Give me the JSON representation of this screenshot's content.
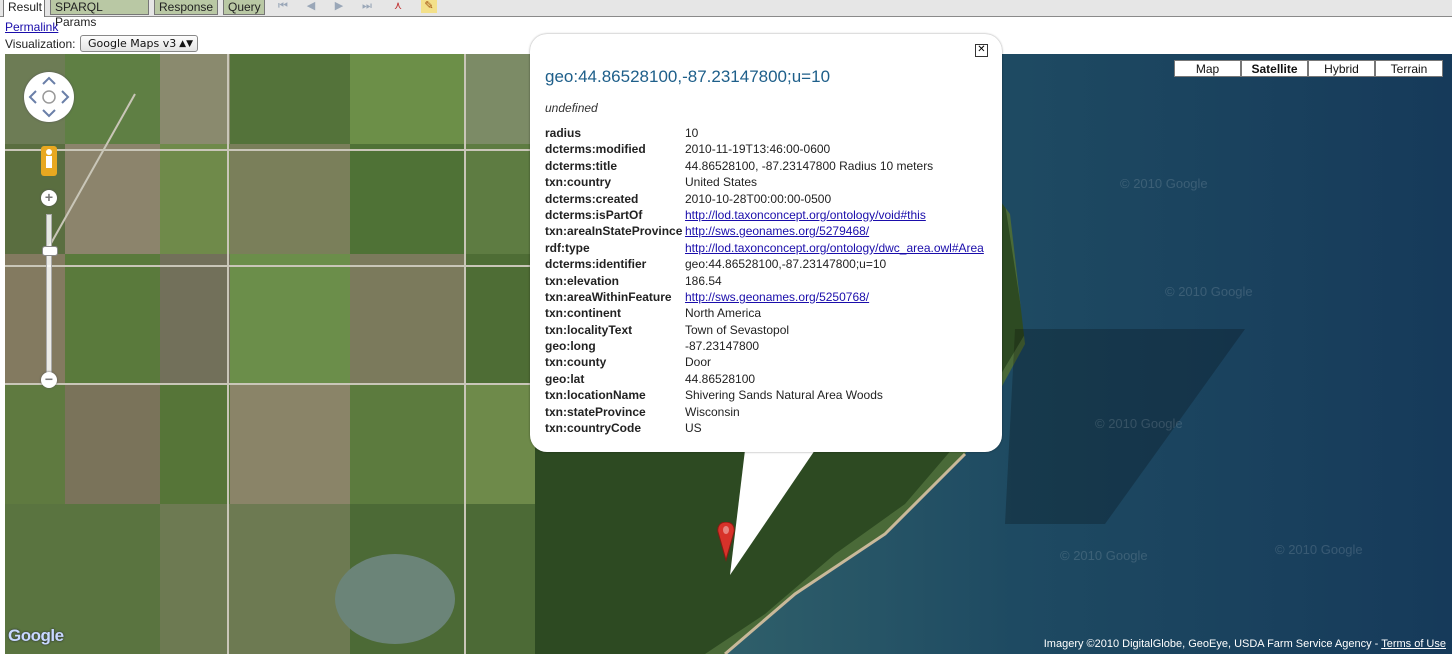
{
  "tabs": [
    {
      "label": "Result",
      "active": true
    },
    {
      "label": "SPARQL Params",
      "active": false
    },
    {
      "label": "Response",
      "active": false
    },
    {
      "label": "Query",
      "active": false
    }
  ],
  "toolbar_icons": [
    "first-page-icon",
    "prev-page-icon",
    "next-page-icon",
    "last-page-icon",
    "graph-icon",
    "edit-icon"
  ],
  "permalink": "Permalink",
  "visualization": {
    "label": "Visualization:",
    "selected": "Google Maps v3"
  },
  "map": {
    "types": [
      {
        "label": "Map",
        "selected": false
      },
      {
        "label": "Satellite",
        "selected": true
      },
      {
        "label": "Hybrid",
        "selected": false
      },
      {
        "label": "Terrain",
        "selected": false
      }
    ],
    "watermark": "© 2010 Google",
    "logo": "Google",
    "attribution": "Imagery ©2010 DigitalGlobe, GeoEye, USDA Farm Service Agency -",
    "terms": "Terms of Use"
  },
  "popup": {
    "title": "geo:44.86528100,-87.23147800;u=10",
    "subtitle": "undefined",
    "close_label": "✕",
    "properties": [
      {
        "key": "radius",
        "value": "10",
        "link": false
      },
      {
        "key": "dcterms:modified",
        "value": "2010-11-19T13:46:00-0600",
        "link": false
      },
      {
        "key": "dcterms:title",
        "value": "44.86528100, -87.23147800 Radius 10 meters",
        "link": false
      },
      {
        "key": "txn:country",
        "value": "United States",
        "link": false
      },
      {
        "key": "dcterms:created",
        "value": "2010-10-28T00:00:00-0500",
        "link": false
      },
      {
        "key": "dcterms:isPartOf",
        "value": "http://lod.taxonconcept.org/ontology/void#this",
        "link": true
      },
      {
        "key": "txn:areaInStateProvince",
        "value": "http://sws.geonames.org/5279468/",
        "link": true
      },
      {
        "key": "rdf:type",
        "value": "http://lod.taxonconcept.org/ontology/dwc_area.owl#Area",
        "link": true
      },
      {
        "key": "dcterms:identifier",
        "value": "geo:44.86528100,-87.23147800;u=10",
        "link": false
      },
      {
        "key": "txn:elevation",
        "value": "186.54",
        "link": false
      },
      {
        "key": "txn:areaWithinFeature",
        "value": "http://sws.geonames.org/5250768/",
        "link": true
      },
      {
        "key": "txn:continent",
        "value": "North America",
        "link": false
      },
      {
        "key": "txn:localityText",
        "value": "Town of Sevastopol",
        "link": false
      },
      {
        "key": "geo:long",
        "value": "-87.23147800",
        "link": false
      },
      {
        "key": "txn:county",
        "value": "Door",
        "link": false
      },
      {
        "key": "geo:lat",
        "value": "44.86528100",
        "link": false
      },
      {
        "key": "txn:locationName",
        "value": "Shivering Sands Natural Area Woods",
        "link": false
      },
      {
        "key": "txn:stateProvince",
        "value": "Wisconsin",
        "link": false
      },
      {
        "key": "txn:countryCode",
        "value": "US",
        "link": false
      }
    ]
  }
}
